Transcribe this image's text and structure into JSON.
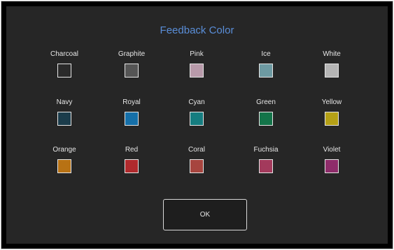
{
  "dialog": {
    "title": "Feedback Color",
    "title_color": "#5a8ed8",
    "ok_label": "OK"
  },
  "colors": [
    {
      "name": "Charcoal",
      "hex": "#2a2a2a"
    },
    {
      "name": "Graphite",
      "hex": "#555555"
    },
    {
      "name": "Pink",
      "hex": "#b89aaa"
    },
    {
      "name": "Ice",
      "hex": "#6d9aa2"
    },
    {
      "name": "White",
      "hex": "#b5b5b5"
    },
    {
      "name": "Navy",
      "hex": "#1b3c4b"
    },
    {
      "name": "Royal",
      "hex": "#156fa8"
    },
    {
      "name": "Cyan",
      "hex": "#157d80"
    },
    {
      "name": "Green",
      "hex": "#137449"
    },
    {
      "name": "Yellow",
      "hex": "#b4a016"
    },
    {
      "name": "Orange",
      "hex": "#b87214"
    },
    {
      "name": "Red",
      "hex": "#b02a2d"
    },
    {
      "name": "Coral",
      "hex": "#a7453f"
    },
    {
      "name": "Fuchsia",
      "hex": "#a33a5c"
    },
    {
      "name": "Violet",
      "hex": "#8e2c6a"
    }
  ]
}
